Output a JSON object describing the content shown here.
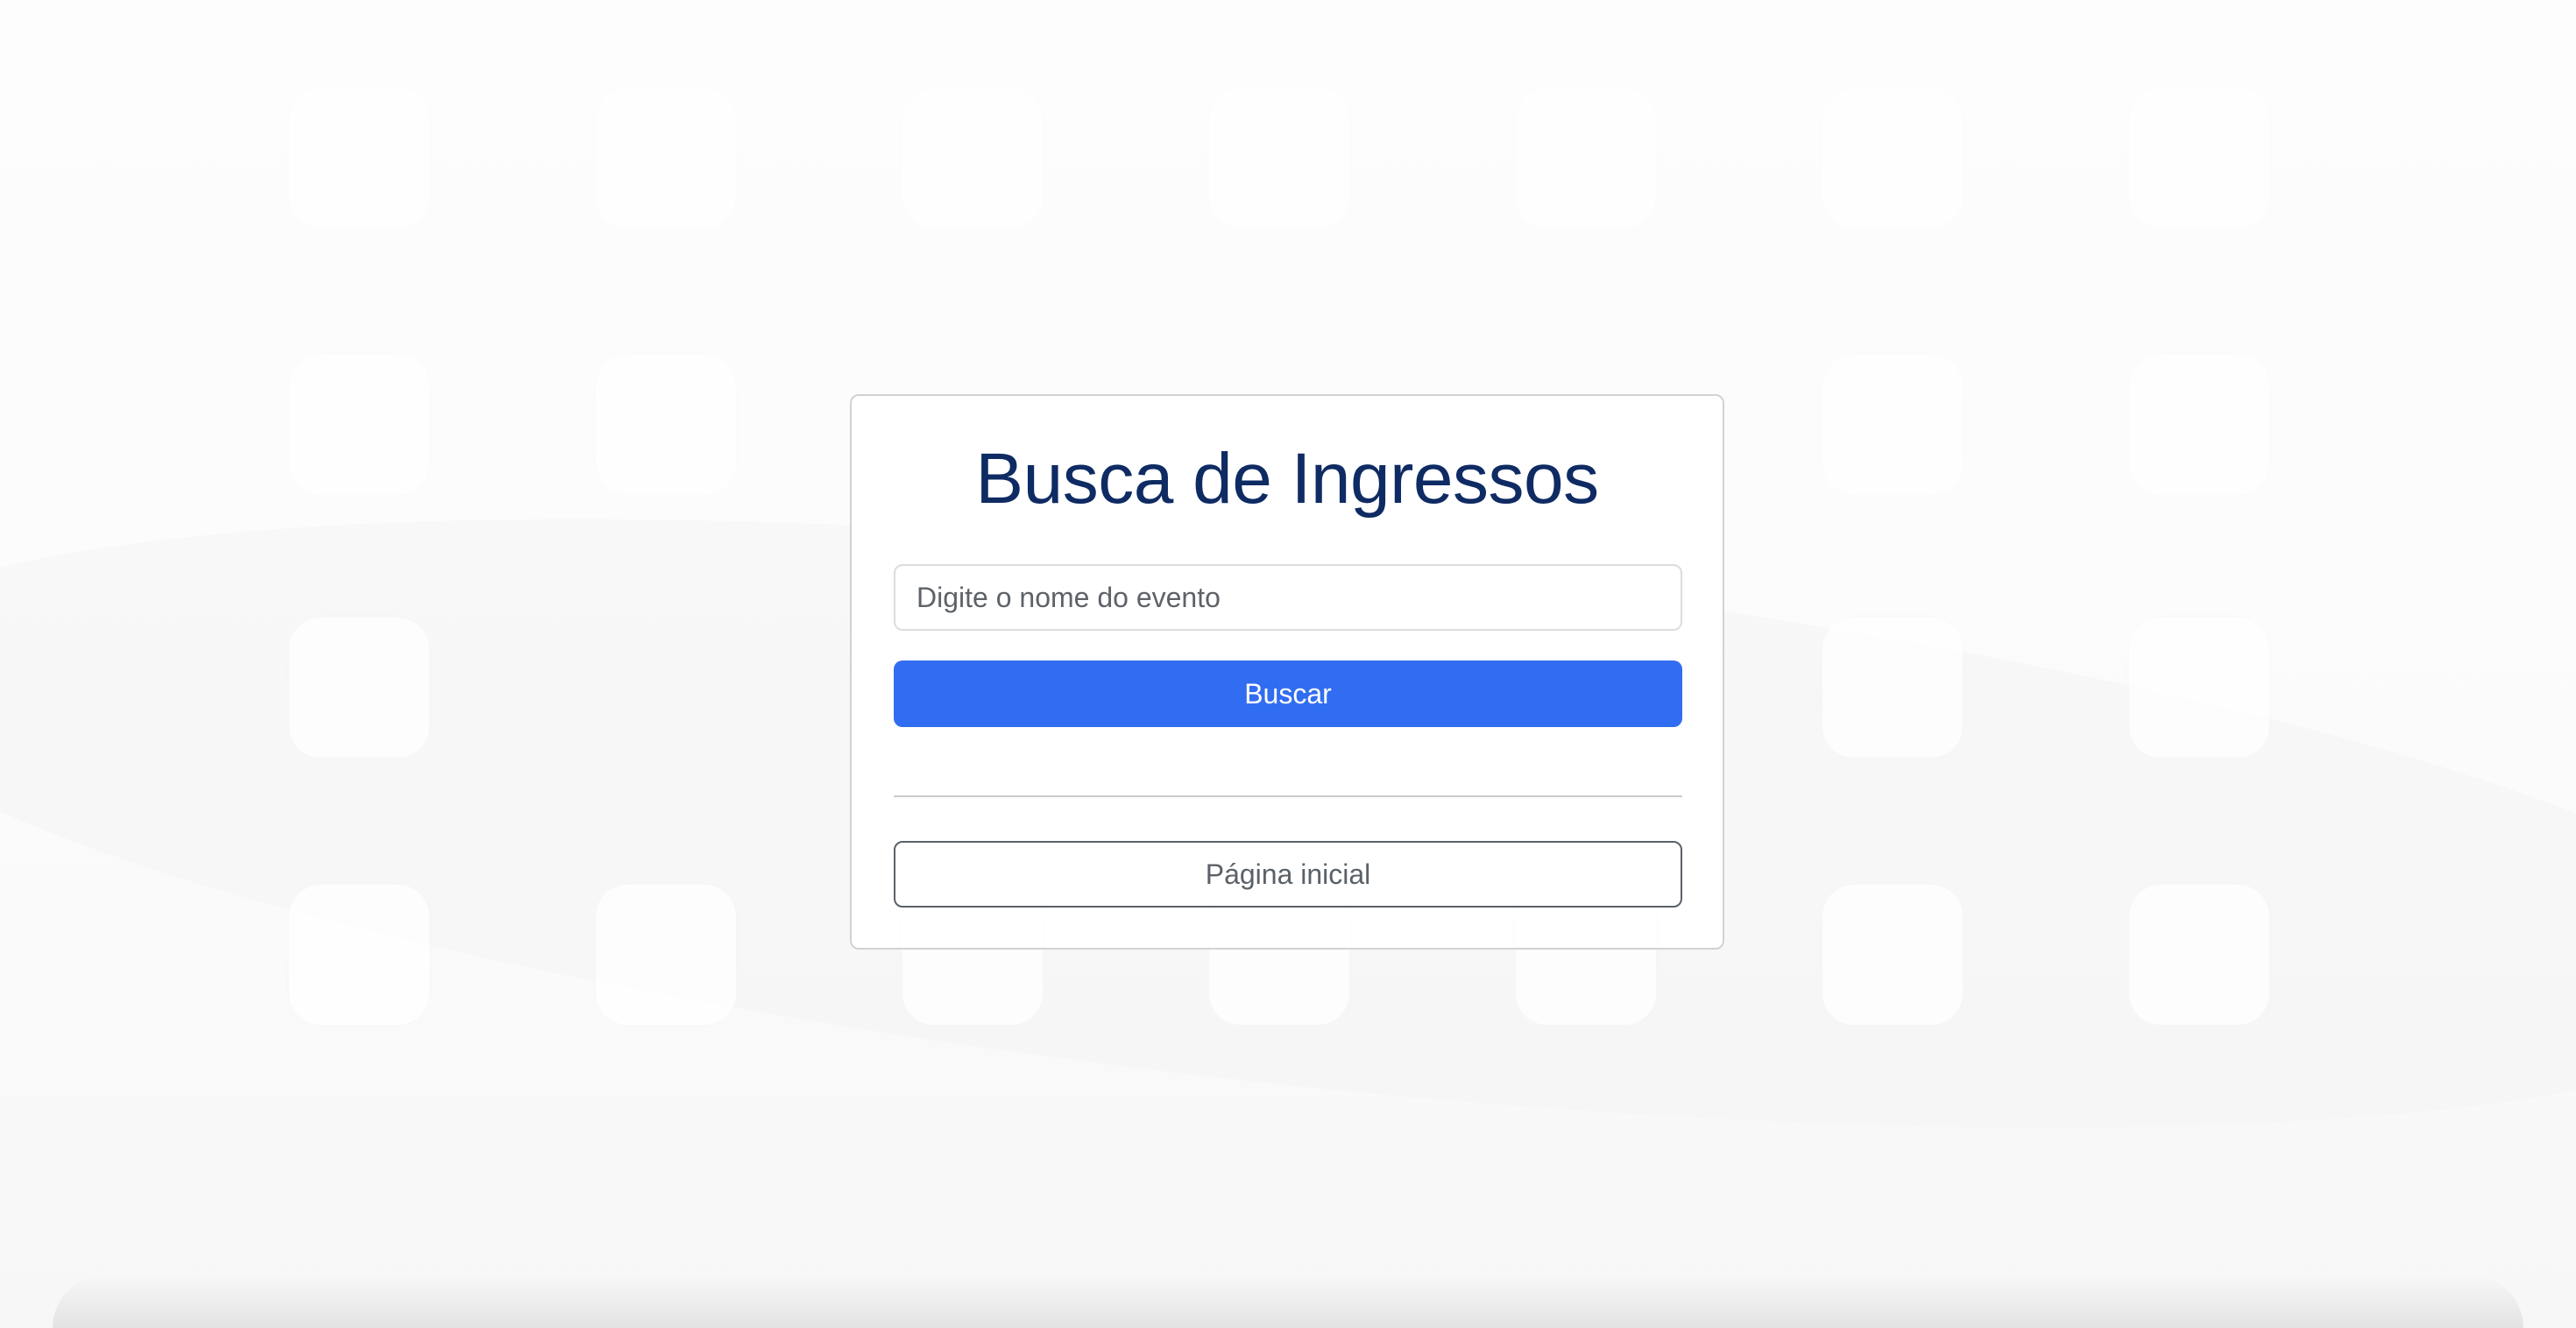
{
  "page": {
    "title": "Busca de Ingressos"
  },
  "search": {
    "placeholder": "Digite o nome do evento",
    "value": "",
    "button_label": "Buscar"
  },
  "navigation": {
    "home_label": "Página inicial"
  },
  "colors": {
    "title": "#0f2b63",
    "primary_button": "#316df1",
    "secondary_button_border": "#5b6168",
    "background": "#fbfbfb"
  }
}
